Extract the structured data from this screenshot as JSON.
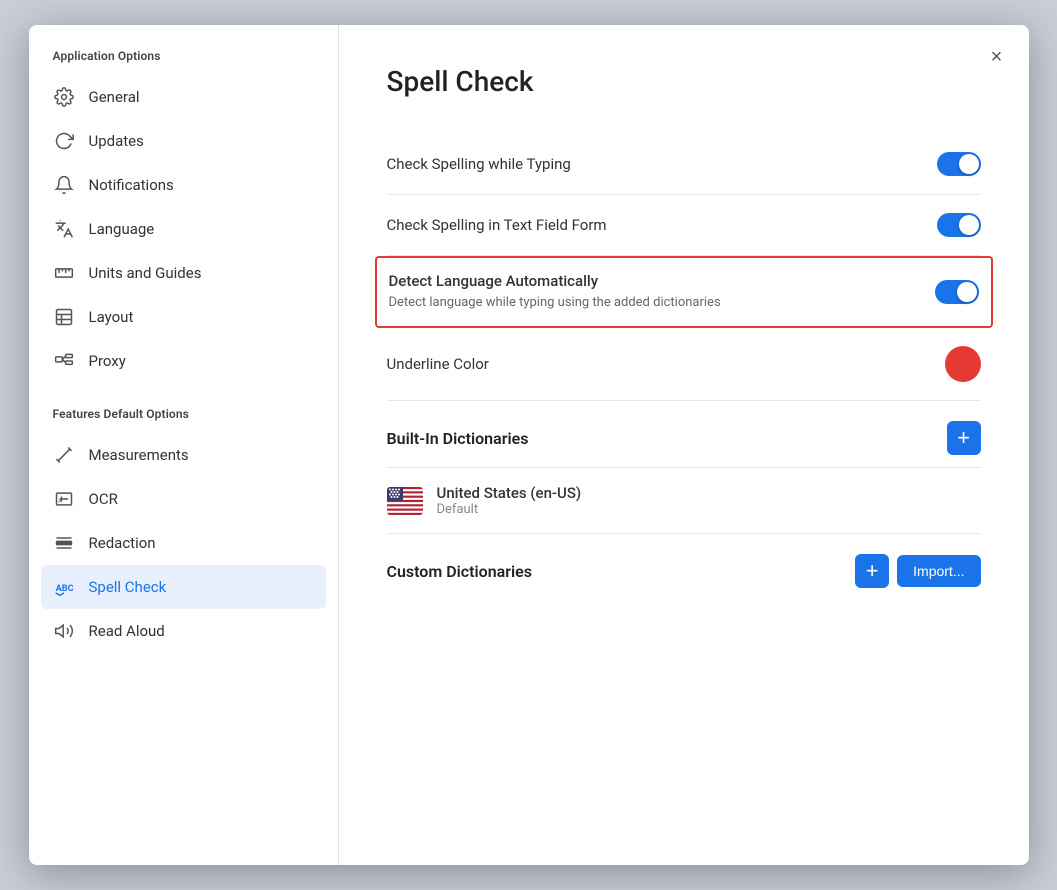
{
  "modal": {
    "title": "Spell Check",
    "close_label": "×"
  },
  "sidebar": {
    "app_options_title": "Application Options",
    "features_title": "Features Default Options",
    "items_app": [
      {
        "id": "general",
        "label": "General",
        "icon": "gear"
      },
      {
        "id": "updates",
        "label": "Updates",
        "icon": "refresh"
      },
      {
        "id": "notifications",
        "label": "Notifications",
        "icon": "bell"
      },
      {
        "id": "language",
        "label": "Language",
        "icon": "translate"
      },
      {
        "id": "units",
        "label": "Units and Guides",
        "icon": "ruler"
      },
      {
        "id": "layout",
        "label": "Layout",
        "icon": "layout"
      },
      {
        "id": "proxy",
        "label": "Proxy",
        "icon": "proxy"
      }
    ],
    "items_features": [
      {
        "id": "measurements",
        "label": "Measurements",
        "icon": "measure"
      },
      {
        "id": "ocr",
        "label": "OCR",
        "icon": "ocr"
      },
      {
        "id": "redaction",
        "label": "Redaction",
        "icon": "redact"
      },
      {
        "id": "spellcheck",
        "label": "Spell Check",
        "icon": "abc",
        "active": true
      },
      {
        "id": "readaloud",
        "label": "Read Aloud",
        "icon": "speaker"
      }
    ]
  },
  "settings": {
    "check_spelling_typing": "Check Spelling while Typing",
    "check_spelling_form": "Check Spelling in Text Field Form",
    "detect_lang_title": "Detect Language Automatically",
    "detect_lang_desc": "Detect language while typing using the added dictionaries",
    "underline_color": "Underline Color",
    "built_in_title": "Built-In Dictionaries",
    "add_button": "+",
    "dictionary_name": "United States (en-US)",
    "dictionary_sub": "Default",
    "custom_dict_title": "Custom Dictionaries",
    "import_button": "Import...",
    "add_custom_button": "+"
  }
}
